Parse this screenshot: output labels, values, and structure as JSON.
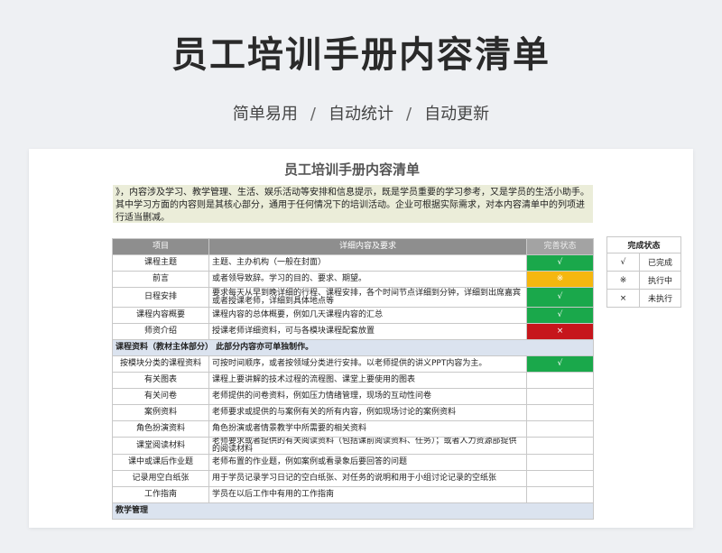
{
  "hero": {
    "title": "员工培训手册内容清单",
    "sub1": "简单易用",
    "sub2": "自动统计",
    "sub3": "自动更新",
    "sep": "/"
  },
  "sheet": {
    "title": "员工培训手册内容清单",
    "intro": "》，内容涉及学习、教学管理、生活、娱乐活动等安排和信息提示，既是学员重要的学习参考，又是学员的生活小助手。其中学习方面的内容则是其核心部分，通用于任何情况下的培训活动。企业可根据实际需求，对本内容清单中的列项进行适当删减。"
  },
  "table": {
    "headers": {
      "item": "项目",
      "detail": "详细内容及要求",
      "status": "完善状态"
    },
    "rows": [
      {
        "item": "课程主题",
        "detail": "主题、主办机构（一般在封面）",
        "status": "√",
        "state": "done"
      },
      {
        "item": "前言",
        "detail": "或者领导致辞。学习的目的、要求、期望。",
        "status": "※",
        "state": "doing"
      },
      {
        "item": "日程安排",
        "detail": "要求每天从早到晚详细的行程、课程安排，各个时间节点详细到分钟，详细到出席嘉宾或者授课老师，详细到具体地点等",
        "status": "√",
        "state": "done",
        "tall": true
      },
      {
        "item": "课程内容概要",
        "detail": "课程内容的总体概要，例如几天课程内容的汇总",
        "status": "√",
        "state": "done"
      },
      {
        "item": "师资介绍",
        "detail": "授课老师详细资料，可与各模块课程配套放置",
        "status": "×",
        "state": "todo"
      },
      {
        "section": "课程资料（教材主体部分）  此部分内容亦可单独制作。"
      },
      {
        "item": "按模块分类的课程资料",
        "detail": "可按时间顺序，或者按领域分类进行安排。以老师提供的讲义PPT内容为主。",
        "status": "√",
        "state": "done"
      },
      {
        "item": "有关图表",
        "detail": "课程上要讲解的技术过程的流程图、课堂上要使用的图表",
        "status": "",
        "state": ""
      },
      {
        "item": "有关问卷",
        "detail": "老师提供的问卷资料，例如压力情绪管理，现场的互动性问卷",
        "status": "",
        "state": ""
      },
      {
        "item": "案例资料",
        "detail": "老师要求或提供的与案例有关的所有内容，例如现场讨论的案例资料",
        "status": "",
        "state": ""
      },
      {
        "item": "角色扮演资料",
        "detail": "角色扮演或者情景教学中所需要的相关资料",
        "status": "",
        "state": ""
      },
      {
        "item": "课堂阅读材料",
        "detail": "老师要求或者提供的有关阅读资料（包括课前阅读资料、任务）；或者人力资源部提供的阅读材料",
        "status": "",
        "state": ""
      },
      {
        "item": "课中或课后作业题",
        "detail": "老师布置的作业题，例如案例或看录象后要回答的问题",
        "status": "",
        "state": ""
      },
      {
        "item": "记录用空白纸张",
        "detail": "用于学员记录学习日记的空白纸张、对任务的说明和用于小组讨论记录的空纸张",
        "status": "",
        "state": ""
      },
      {
        "item": "工作指南",
        "detail": "学员在以后工作中有用的工作指南",
        "status": "",
        "state": ""
      },
      {
        "section": "教学管理"
      }
    ]
  },
  "legend": {
    "header": "完成状态",
    "rows": [
      {
        "symbol": "√",
        "label": "已完成"
      },
      {
        "symbol": "※",
        "label": "执行中"
      },
      {
        "symbol": "×",
        "label": "未执行"
      }
    ]
  },
  "colors": {
    "done": "#1aa84b",
    "doing": "#f5b70f",
    "todo": "#c6161c",
    "header": "#8e8e8e",
    "section": "#dbe3ef",
    "intro": "#ebedd9"
  }
}
